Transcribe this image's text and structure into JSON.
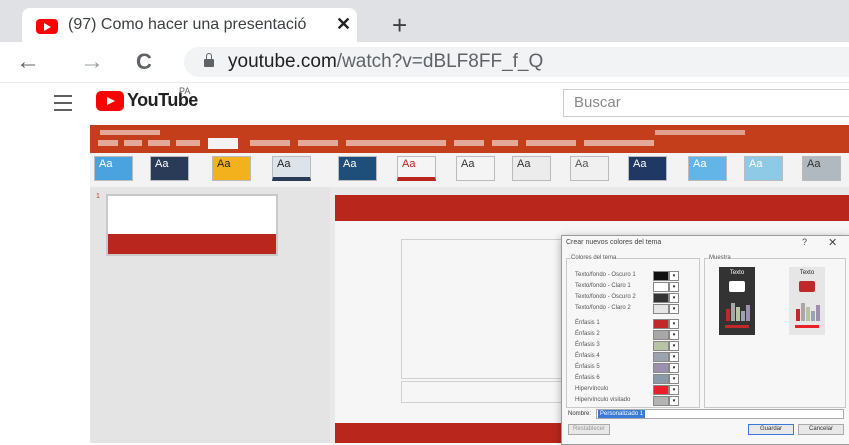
{
  "browser": {
    "tab_title": "(97) Como hacer una presentació",
    "tab_close": "✕",
    "new_tab": "+",
    "back": "←",
    "forward": "→",
    "reload": "C",
    "url_domain": "youtube.com",
    "url_path": "/watch?v=dBLF8FF_f_Q"
  },
  "youtube": {
    "logo_text": "YouTube",
    "country_code": "PA",
    "search_placeholder": "Buscar"
  },
  "powerpoint": {
    "theme_thumb_labels": [
      "Aa",
      "Aa",
      "Aa",
      "Aa",
      "Aa",
      "Aa",
      "Aa",
      "Aa",
      "Aa",
      "Aa",
      "Aa",
      "Aa",
      "Aa"
    ],
    "slide_number": "1"
  },
  "dialog": {
    "title": "Crear nuevos colores del tema",
    "help": "?",
    "close": "✕",
    "group_colors": "Colores del tema",
    "group_preview": "Muestra",
    "rows": [
      {
        "label": "Texto/fondo - Oscuro 1",
        "color": "#111111"
      },
      {
        "label": "Texto/fondo - Claro 1",
        "color": "#ffffff"
      },
      {
        "label": "Texto/fondo - Oscuro 2",
        "color": "#333333"
      },
      {
        "label": "Texto/fondo - Claro 2",
        "color": "#e6e6e6"
      },
      {
        "label": "Énfasis 1",
        "color": "#c0282a"
      },
      {
        "label": "Énfasis 2",
        "color": "#a7a7a7"
      },
      {
        "label": "Énfasis 3",
        "color": "#b8c2a5"
      },
      {
        "label": "Énfasis 4",
        "color": "#9aa3ae"
      },
      {
        "label": "Énfasis 5",
        "color": "#9c8faf"
      },
      {
        "label": "Énfasis 6",
        "color": "#8a9aa9"
      },
      {
        "label": "Hipervínculo",
        "color": "#e8202a"
      },
      {
        "label": "Hipervínculo visitado",
        "color": "#b3b3b3"
      }
    ],
    "preview_dark_label": "Texto",
    "preview_light_label": "Texto",
    "name_label": "Nombre:",
    "name_value": "Personalizado 1",
    "reset_button": "Restablecer",
    "save_button": "Guardar",
    "cancel_button": "Cancelar"
  }
}
